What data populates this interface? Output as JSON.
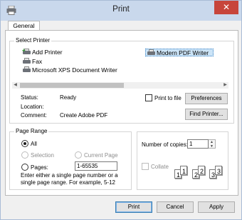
{
  "window": {
    "title": "Print",
    "close_label": "✕"
  },
  "tabs": [
    {
      "label": "General"
    }
  ],
  "select_printer": {
    "group_title": "Select Printer",
    "printers": [
      {
        "label": "Add Printer",
        "icon": "add-printer-icon"
      },
      {
        "label": "Fax",
        "icon": "printer-icon"
      },
      {
        "label": "Microsoft XPS Document Writer",
        "icon": "printer-icon"
      },
      {
        "label": "Modern PDF Writer",
        "icon": "printer-icon",
        "selected": true
      }
    ],
    "status_label": "Status:",
    "status_value": "Ready",
    "location_label": "Location:",
    "location_value": "",
    "comment_label": "Comment:",
    "comment_value": "Create Adobe PDF",
    "print_to_file_label": "Print to file",
    "preferences_label": "Preferences",
    "find_printer_label": "Find Printer..."
  },
  "page_range": {
    "group_title": "Page Range",
    "all_label": "All",
    "selection_label": "Selection",
    "current_page_label": "Current Page",
    "pages_label": "Pages:",
    "pages_value": "1-65535",
    "hint": "Enter either a single page number or a single page range.  For example, 5-12"
  },
  "copies": {
    "number_label": "Number of copies:",
    "number_value": "1",
    "collate_label": "Collate"
  },
  "buttons": {
    "print": "Print",
    "cancel": "Cancel",
    "apply": "Apply"
  },
  "colors": {
    "titlebar": "#c9d8ec",
    "close": "#c7453b",
    "selection": "#cce4f7"
  }
}
